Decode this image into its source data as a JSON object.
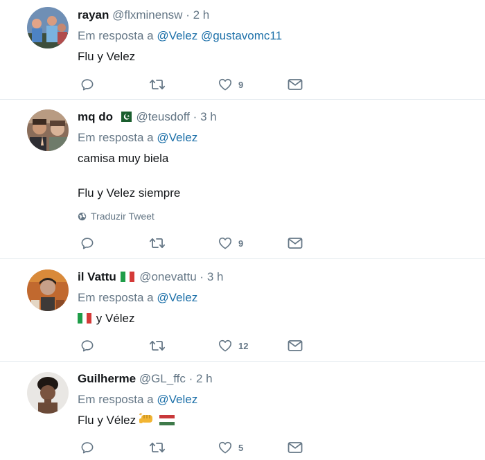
{
  "reply_prefix": "Em resposta a",
  "translate_label": "Traduzir Tweet",
  "tweets": [
    {
      "name": "rayan",
      "handle": "@flxminensw",
      "time": "2 h",
      "mentions": [
        "@Velez",
        "@gustavomc11"
      ],
      "lines": [
        "Flu y Velez"
      ],
      "likes": "9"
    },
    {
      "name": "mq do",
      "handle": "@teusdoff",
      "time": "3 h",
      "mentions": [
        "@Velez"
      ],
      "lines": [
        "camisa muy biela",
        "Flu y Velez siempre"
      ],
      "likes": "9"
    },
    {
      "name": "il Vattu",
      "handle": "@onevattu",
      "time": "3 h",
      "mentions": [
        "@Velez"
      ],
      "lines": [
        "y Vélez"
      ],
      "likes": "12"
    },
    {
      "name": "Guilherme",
      "handle": "@GL_ffc",
      "time": "2 h",
      "mentions": [
        "@Velez"
      ],
      "lines": [
        "Flu y Vélez"
      ],
      "likes": "5"
    }
  ],
  "icons": {
    "reply": "reply-icon",
    "retweet": "retweet-icon",
    "like": "heart-icon",
    "message": "envelope-icon",
    "globe": "globe-icon"
  },
  "colors": {
    "mention": "#1b6fa8",
    "muted": "#657786",
    "divider": "#e6ecf0"
  }
}
